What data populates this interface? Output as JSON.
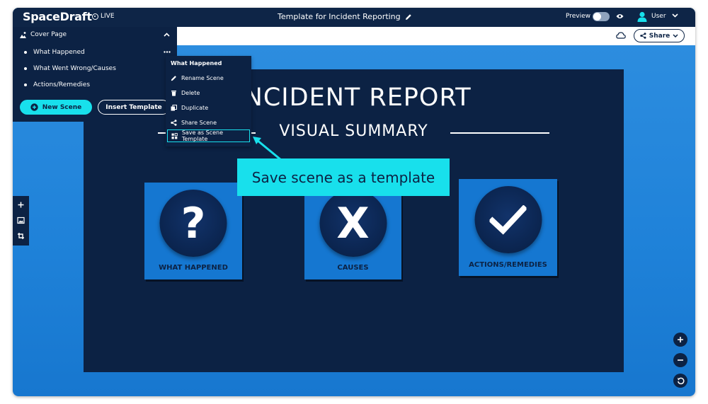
{
  "app": {
    "name": "SpaceDraft",
    "live_label": "LIVE"
  },
  "document": {
    "title": "Template for Incident Reporting"
  },
  "header": {
    "preview_label": "Preview",
    "user_label": "User"
  },
  "toolbar": {
    "share_label": "Share"
  },
  "scenes_panel": {
    "cover_label": "Cover Page",
    "items": [
      {
        "label": "What Happened"
      },
      {
        "label": "What Went Wrong/Causes"
      },
      {
        "label": "Actions/Remedies"
      }
    ],
    "new_scene_label": "New Scene",
    "insert_template_label": "Insert Template"
  },
  "context_menu": {
    "title": "What Happened",
    "items": [
      {
        "label": "Rename Scene",
        "icon": "pencil-icon"
      },
      {
        "label": "Delete",
        "icon": "trash-icon"
      },
      {
        "label": "Duplicate",
        "icon": "duplicate-icon"
      },
      {
        "label": "Share Scene",
        "icon": "share-icon"
      },
      {
        "label": "Save as Scene Template",
        "icon": "template-icon"
      }
    ]
  },
  "callout": {
    "text": "Save scene as a template"
  },
  "slide": {
    "title": "INCIDENT REPORT",
    "subtitle": "VISUAL SUMMARY",
    "cards": [
      {
        "label": "WHAT HAPPENED",
        "symbol": "?"
      },
      {
        "label": "CAUSES",
        "symbol": "X"
      },
      {
        "label": "ACTIONS/REMEDIES",
        "symbol": "check"
      }
    ]
  },
  "colors": {
    "navy": "#0c2244",
    "accent_cyan": "#18e0ec",
    "card_blue": "#1577d1",
    "background_blue": "#2f8fe0"
  }
}
